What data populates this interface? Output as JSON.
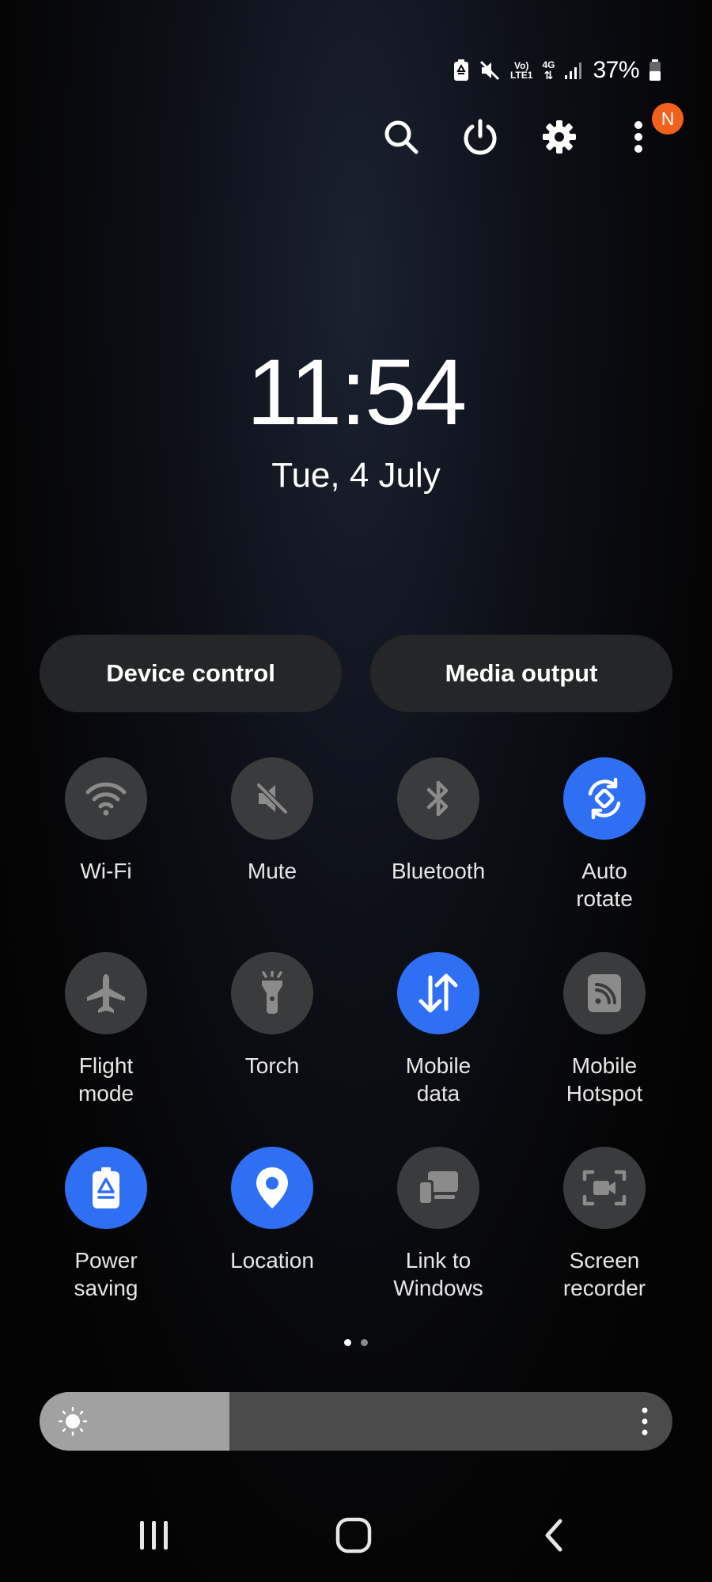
{
  "status_bar": {
    "icons": [
      "battery-saver-icon",
      "mute-icon",
      "volte-icon",
      "4g-data-icon",
      "signal-icon",
      "battery-icon"
    ],
    "volte_line1": "Vo)",
    "volte_line2": "LTE1",
    "network": "4G",
    "battery_percent": "37%"
  },
  "top_actions": {
    "icons": [
      "search-icon",
      "power-icon",
      "gear-icon",
      "more-vert-icon"
    ],
    "notification_badge": "N"
  },
  "clock": {
    "time": "11:54",
    "date": "Tue, 4 July"
  },
  "buttons": {
    "device_control": "Device control",
    "media_output": "Media output"
  },
  "tiles": [
    {
      "label_line1": "Wi-Fi",
      "label_line2": "",
      "icon": "wifi-icon",
      "active": false
    },
    {
      "label_line1": "Mute",
      "label_line2": "",
      "icon": "mute-icon",
      "active": false
    },
    {
      "label_line1": "Bluetooth",
      "label_line2": "",
      "icon": "bluetooth-icon",
      "active": false
    },
    {
      "label_line1": "Auto",
      "label_line2": "rotate",
      "icon": "auto-rotate-icon",
      "active": true
    },
    {
      "label_line1": "Flight",
      "label_line2": "mode",
      "icon": "airplane-icon",
      "active": false
    },
    {
      "label_line1": "Torch",
      "label_line2": "",
      "icon": "torch-icon",
      "active": false
    },
    {
      "label_line1": "Mobile",
      "label_line2": "data",
      "icon": "mobile-data-icon",
      "active": true
    },
    {
      "label_line1": "Mobile",
      "label_line2": "Hotspot",
      "icon": "hotspot-icon",
      "active": false
    },
    {
      "label_line1": "Power",
      "label_line2": "saving",
      "icon": "power-saving-icon",
      "active": true
    },
    {
      "label_line1": "Location",
      "label_line2": "",
      "icon": "location-pin-icon",
      "active": true
    },
    {
      "label_line1": "Link to",
      "label_line2": "Windows",
      "icon": "link-to-windows-icon",
      "active": false
    },
    {
      "label_line1": "Screen",
      "label_line2": "recorder",
      "icon": "screen-recorder-icon",
      "active": false
    }
  ],
  "pager": {
    "pages": 2,
    "current": 1
  },
  "brightness": {
    "level_fraction": 0.3
  },
  "colors": {
    "accent": "#2f6ff3",
    "tile_off": "#3a3b3d",
    "badge": "#f2611b"
  },
  "nav_bar": {
    "icons": [
      "recents-icon",
      "home-icon",
      "back-icon"
    ]
  }
}
